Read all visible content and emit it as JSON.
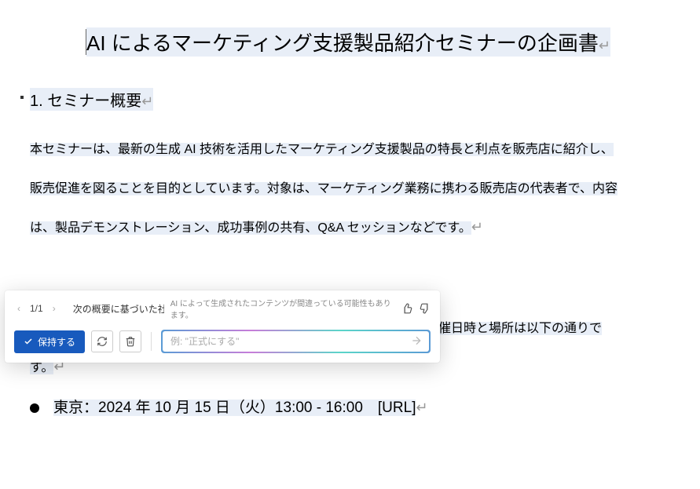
{
  "document": {
    "title": "AI によるマーケティング支援製品紹介セミナーの企画書",
    "section1_heading": "1. セミナー概要",
    "body1_line1": "本セミナーは、最新の生成 AI 技術を活用したマーケティング支援製品の特長と利点を販売店に紹介し、",
    "body1_line2": "販売促進を図ることを目的としています。対象は、マーケティング業務に携わる販売店の代表者で、内容",
    "body1_line3": "は、製品デモンストレーション、成功事例の共有、Q&A セッションなどです。",
    "body2_line1_tail": "催日時と場所は以下の通りで",
    "body2_line2": "す。",
    "list_item1": "東京：2024 年 10 月 15 日（火）13:00 - 16:00　[URL]",
    "paragraph_mark": "↵"
  },
  "ai_popup": {
    "nav": {
      "prev": "‹",
      "next": "›",
      "count": "1/1"
    },
    "note": "次の概要に基づいた社...",
    "disclaimer": "AI によって生成されたコンテンツが間違っている可能性もあります。",
    "keep_label": "保持する",
    "prompt_placeholder": "例: \"正式にする\""
  }
}
